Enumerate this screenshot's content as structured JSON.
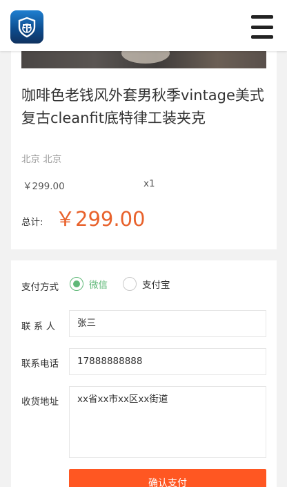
{
  "header": {
    "logo_icon": "shield-logo-icon",
    "menu_icon": "hamburger-menu-icon"
  },
  "product": {
    "title": "咖啡色老钱风外套男秋季vintage美式复古cleanfit底特律工装夹克",
    "location": "北京 北京",
    "unit_price": "￥299.00",
    "quantity": "x1",
    "total_label": "总计:",
    "total_value": "￥299.00"
  },
  "payment": {
    "method_label": "支付方式",
    "options": [
      {
        "label": "微信",
        "selected": true
      },
      {
        "label": "支付宝",
        "selected": false
      }
    ],
    "contact_label": "联 系 人",
    "contact_value": "张三",
    "phone_label": "联系电话",
    "phone_value": "17888888888",
    "address_label": "收货地址",
    "address_value": "xx省xx市xx区xx街道",
    "submit_label": "确认支付"
  },
  "colors": {
    "accent_green": "#5fb878",
    "price_orange": "#e8622c",
    "button_orange": "#ff5722"
  }
}
